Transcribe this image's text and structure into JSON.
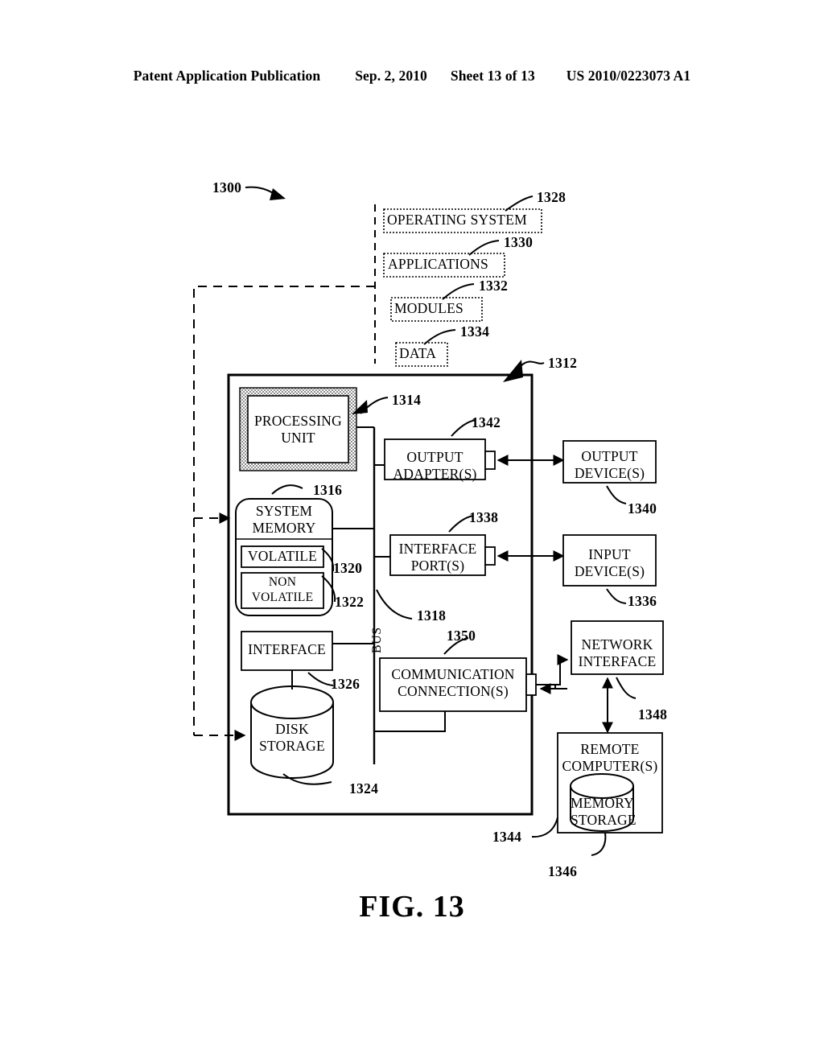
{
  "header": {
    "publication": "Patent Application Publication",
    "date": "Sep. 2, 2010",
    "sheet": "Sheet 13 of 13",
    "pub_number": "US 2010/0223073 A1"
  },
  "figure": {
    "caption": "FIG.  13",
    "system_ref": "1300"
  },
  "software_stack": [
    {
      "label": "OPERATING SYSTEM",
      "ref": "1328"
    },
    {
      "label": "APPLICATIONS",
      "ref": "1330"
    },
    {
      "label": "MODULES",
      "ref": "1332"
    },
    {
      "label": "DATA",
      "ref": "1334"
    }
  ],
  "computer": {
    "ref": "1312",
    "bus_label": "BUS",
    "bus_ref": "1318",
    "blocks": {
      "processing_unit": {
        "label": "PROCESSING\nUNIT",
        "ref": "1314"
      },
      "system_memory": {
        "label": "SYSTEM\nMEMORY",
        "ref": "1316"
      },
      "volatile": {
        "label": "VOLATILE",
        "ref": "1320"
      },
      "non_volatile": {
        "label": "NON\nVOLATILE",
        "ref": "1322"
      },
      "interface": {
        "label": "INTERFACE",
        "ref": "1326"
      },
      "disk_storage": {
        "label": "DISK\nSTORAGE",
        "ref": "1324"
      },
      "output_adapter": {
        "label": "OUTPUT\nADAPTER(S)",
        "ref": "1342"
      },
      "interface_port": {
        "label": "INTERFACE\nPORT(S)",
        "ref": "1338"
      },
      "communication": {
        "label": "COMMUNICATION\nCONNECTION(S)",
        "ref": "1350"
      }
    }
  },
  "peripherals": {
    "output_device": {
      "label": "OUTPUT\nDEVICE(S)",
      "ref": "1340"
    },
    "input_device": {
      "label": "INPUT\nDEVICE(S)",
      "ref": "1336"
    },
    "network_interface": {
      "label": "NETWORK\nINTERFACE",
      "ref": "1348"
    },
    "remote_computer": {
      "label": "REMOTE\nCOMPUTER(S)",
      "ref": "1344"
    },
    "memory_storage": {
      "label": "MEMORY\nSTORAGE",
      "ref": "1346"
    }
  },
  "colors": {
    "ink": "#000000",
    "paper": "#ffffff",
    "hatch": "#8a8a8a"
  }
}
